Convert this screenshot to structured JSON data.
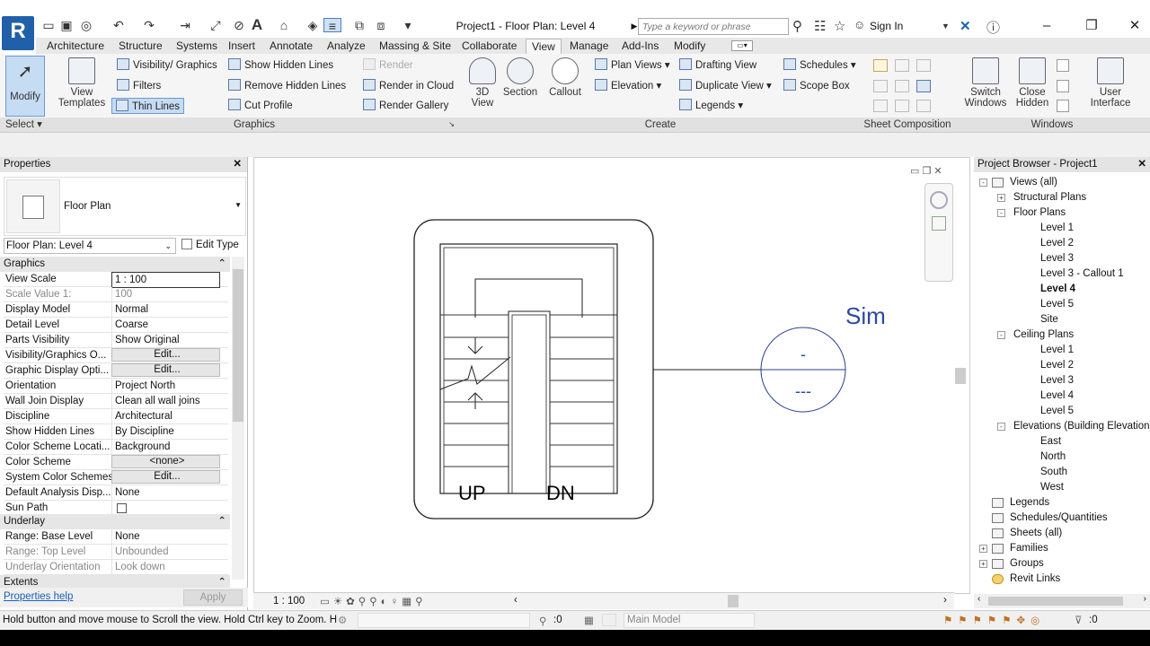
{
  "app": {
    "logo": "R",
    "doc_title": "Project1 - Floor Plan: Level 4",
    "search_placeholder": "Type a keyword or phrase",
    "sign_in": "Sign In"
  },
  "tabs": [
    "Architecture",
    "Structure",
    "Systems",
    "Insert",
    "Annotate",
    "Analyze",
    "Massing & Site",
    "Collaborate",
    "View",
    "Manage",
    "Add-Ins",
    "Modify"
  ],
  "active_tab": "View",
  "ribbon": {
    "modify": "Modify",
    "select": "Select",
    "view_templates": [
      "View",
      "Templates"
    ],
    "visibility_graphics": "Visibility/ Graphics",
    "filters": "Filters",
    "thin_lines": "Thin Lines",
    "show_hidden": "Show  Hidden Lines",
    "remove_hidden": "Remove  Hidden Lines",
    "cut_profile": "Cut  Profile",
    "render": "Render",
    "render_cloud": "Render  in Cloud",
    "render_gallery": "Render  Gallery",
    "view3d": [
      "3D",
      "View"
    ],
    "section": "Section",
    "callout": "Callout",
    "plan_views": "Plan  Views",
    "elevation": "Elevation",
    "drafting_view": "Drafting  View",
    "duplicate_view": "Duplicate  View",
    "legends": "Legends",
    "schedules": "Schedules",
    "scope_box": "Scope  Box",
    "switch_windows": [
      "Switch",
      "Windows"
    ],
    "close_hidden": [
      "Close",
      "Hidden"
    ],
    "user_interface": [
      "User",
      "Interface"
    ],
    "panels": {
      "graphics": "Graphics",
      "create": "Create",
      "sheet_composition": "Sheet Composition",
      "windows": "Windows"
    }
  },
  "properties": {
    "title": "Properties",
    "type": "Floor Plan",
    "instance": "Floor Plan: Level 4",
    "edit_type": "Edit Type",
    "section_graphics": "Graphics",
    "rows": [
      {
        "k": "View Scale",
        "v": "1 : 100"
      },
      {
        "k": "Scale Value    1:",
        "v": "100"
      },
      {
        "k": "Display Model",
        "v": "Normal"
      },
      {
        "k": "Detail Level",
        "v": "Coarse"
      },
      {
        "k": "Parts Visibility",
        "v": "Show Original"
      },
      {
        "k": "Visibility/Graphics O...",
        "v": "Edit..."
      },
      {
        "k": "Graphic Display Opti...",
        "v": "Edit..."
      },
      {
        "k": "Orientation",
        "v": "Project North"
      },
      {
        "k": "Wall Join Display",
        "v": "Clean all wall joins"
      },
      {
        "k": "Discipline",
        "v": "Architectural"
      },
      {
        "k": "Show Hidden Lines",
        "v": "By Discipline"
      },
      {
        "k": "Color Scheme Locati...",
        "v": "Background"
      },
      {
        "k": "Color Scheme",
        "v": "<none>"
      },
      {
        "k": "System Color Schemes",
        "v": "Edit..."
      },
      {
        "k": "Default Analysis Disp...",
        "v": "None"
      },
      {
        "k": "Sun Path",
        "v": ""
      }
    ],
    "section_underlay": "Underlay",
    "underlay_rows": [
      {
        "k": "Range: Base Level",
        "v": "None"
      },
      {
        "k": "Range: Top Level",
        "v": "Unbounded"
      },
      {
        "k": "Underlay Orientation",
        "v": "Look down"
      }
    ],
    "section_extents": "Extents",
    "help": "Properties help",
    "apply": "Apply"
  },
  "canvas": {
    "up": "UP",
    "dn": "DN",
    "sim": "Sim",
    "tag_top": "-",
    "tag_bottom": "---",
    "scale": "1 : 100"
  },
  "browser": {
    "title": "Project Browser - Project1",
    "items": [
      "Views (all)",
      "Structural Plans",
      "Floor Plans",
      "Level 1",
      "Level 2",
      "Level 3",
      "Level 3 - Callout 1",
      "Level 4",
      "Level 5",
      "Site",
      "Ceiling Plans",
      "Level 1",
      "Level 2",
      "Level 3",
      "Level 4",
      "Level 5",
      "Elevations (Building Elevation)",
      "East",
      "North",
      "South",
      "West",
      "Legends",
      "Schedules/Quantities",
      "Sheets (all)",
      "Families",
      "Groups",
      "Revit Links"
    ]
  },
  "status": {
    "message": "Hold button and move mouse to Scroll the view. Hold Ctrl key to Zoom. H",
    "count": ":0",
    "model": "Main Model",
    "filter_count": ":0"
  }
}
